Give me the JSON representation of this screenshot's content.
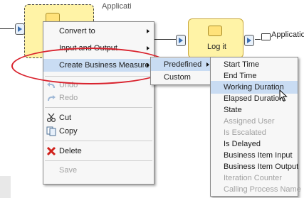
{
  "diagram": {
    "left_label": "Applicati",
    "logit_label": "Log it",
    "right_label": "Application"
  },
  "context_menu": {
    "items": [
      {
        "label": "Convert to",
        "submenu": true,
        "enabled": true
      },
      {
        "label": "Input and Output",
        "submenu": true,
        "enabled": true
      },
      {
        "label": "Create Business Measure",
        "submenu": true,
        "enabled": true,
        "highlighted": true
      },
      {
        "label": "Undo",
        "icon": "undo-icon",
        "enabled": false
      },
      {
        "label": "Redo",
        "icon": "redo-icon",
        "enabled": false
      },
      {
        "label": "Cut",
        "icon": "scissors-icon",
        "enabled": true
      },
      {
        "label": "Copy",
        "icon": "copy-icon",
        "enabled": true
      },
      {
        "label": "Delete",
        "icon": "delete-x-icon",
        "enabled": true
      },
      {
        "label": "Save",
        "enabled": false
      }
    ]
  },
  "submenu_business_measure": {
    "items": [
      {
        "label": "Predefined",
        "submenu": true,
        "highlighted": true
      },
      {
        "label": "Custom",
        "submenu": false
      }
    ]
  },
  "submenu_predefined": {
    "items": [
      {
        "label": "Start Time",
        "enabled": true
      },
      {
        "label": "End Time",
        "enabled": true
      },
      {
        "label": "Working Duration",
        "enabled": true,
        "highlighted": true
      },
      {
        "label": "Elapsed Duration",
        "enabled": true
      },
      {
        "label": "State",
        "enabled": true
      },
      {
        "label": "Assigned User",
        "enabled": false
      },
      {
        "label": "Is Escalated",
        "enabled": false
      },
      {
        "label": "Is Delayed",
        "enabled": true
      },
      {
        "label": "Business Item Input",
        "enabled": true
      },
      {
        "label": "Business Item Output",
        "enabled": true
      },
      {
        "label": "Iteration Counter",
        "enabled": false
      },
      {
        "label": "Calling Process Name",
        "enabled": false
      }
    ]
  },
  "colors": {
    "highlight": "#c9dcf3",
    "annotation_oval": "#d9232e",
    "node_fill": "#fff3a6",
    "disabled_text": "#a2a2a2"
  }
}
